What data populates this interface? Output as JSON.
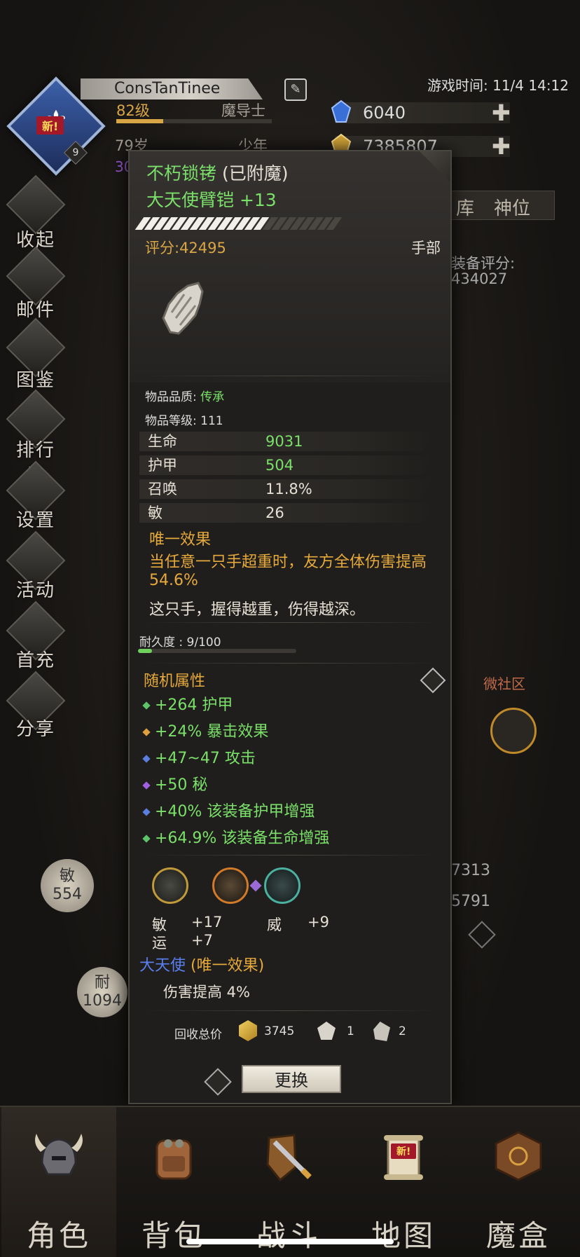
{
  "header": {
    "player_name": "ConsTanTinee",
    "level": "82级",
    "class": "魔导士",
    "age": "79岁",
    "age_stage": "少年",
    "partial_value": "30",
    "game_time_label": "游戏时间: 11/4 14:12",
    "avatar_badge": "新!",
    "avatar_level": "9",
    "gems": "6040",
    "gold": "7385807"
  },
  "side_menu": [
    "收起",
    "邮件",
    "图鉴",
    "排行榜",
    "设置",
    "活动",
    "首充",
    "分享"
  ],
  "background_right": {
    "tab_a": "库",
    "tab_b": "神位",
    "score_label": "装备评分:",
    "score_value": "434027",
    "community": "微社区",
    "stat_a": "7313",
    "stat_b": "5791",
    "help": "?"
  },
  "background_left": {
    "attr_a_label": "敏",
    "attr_a_value": "554",
    "attr_b_label": "耐",
    "attr_b_value": "1094"
  },
  "item": {
    "enchant_name": "不朽锁铐",
    "enchant_status": "(已附魔)",
    "name": "大天使臂铠 +13",
    "score": "评分:42495",
    "slot": "手部",
    "quality_label": "物品品质: ",
    "quality_value": "传承",
    "item_level": "物品等级: 111",
    "stats": [
      {
        "name": "生命",
        "value": "9031",
        "color": "#7be06a"
      },
      {
        "name": "护甲",
        "value": "504",
        "color": "#7be06a"
      },
      {
        "name": "召唤",
        "value": "11.8%",
        "color": "#e6e0d4"
      },
      {
        "name": "敏",
        "value": "26",
        "color": "#e6e0d4"
      }
    ],
    "unique_title": "唯一效果",
    "unique_desc": "当任意一只手超重时，友方全体伤害提高 54.6%",
    "flavor": "这只手，握得越重，伤得越深。",
    "durability_label": "耐久度 : 9/100",
    "durability_fraction": 0.09,
    "random_title": "随机属性",
    "random_stats": [
      {
        "text": "+264 护甲",
        "dot": "#5ec46a"
      },
      {
        "text": "+24% 暴击效果",
        "dot": "#e0a040"
      },
      {
        "text": "+47~47 攻击",
        "dot": "#5a7fe0"
      },
      {
        "text": "+50 秘",
        "dot": "#a060e0"
      },
      {
        "text": "+40% 该装备护甲增强",
        "dot": "#5a7fe0"
      },
      {
        "text": "+64.9% 该装备生命增强",
        "dot": "#5ec46a"
      }
    ],
    "socket_stats": {
      "a_label": "敏",
      "a_value": "+17",
      "b_label": "运",
      "b_value": "+7",
      "c_label": "威",
      "c_value": "+9"
    },
    "set_name": "大天使",
    "set_suffix": "(唯一效果)",
    "set_desc": "伤害提高 4%",
    "recycle_label": "回收总价",
    "recycle_gold": "3745",
    "recycle_a": "1",
    "recycle_b": "2",
    "replace_button": "更换"
  },
  "bottom_nav": [
    "角色",
    "背包",
    "战斗",
    "地图",
    "魔盒"
  ],
  "bottom_badge": "新!"
}
